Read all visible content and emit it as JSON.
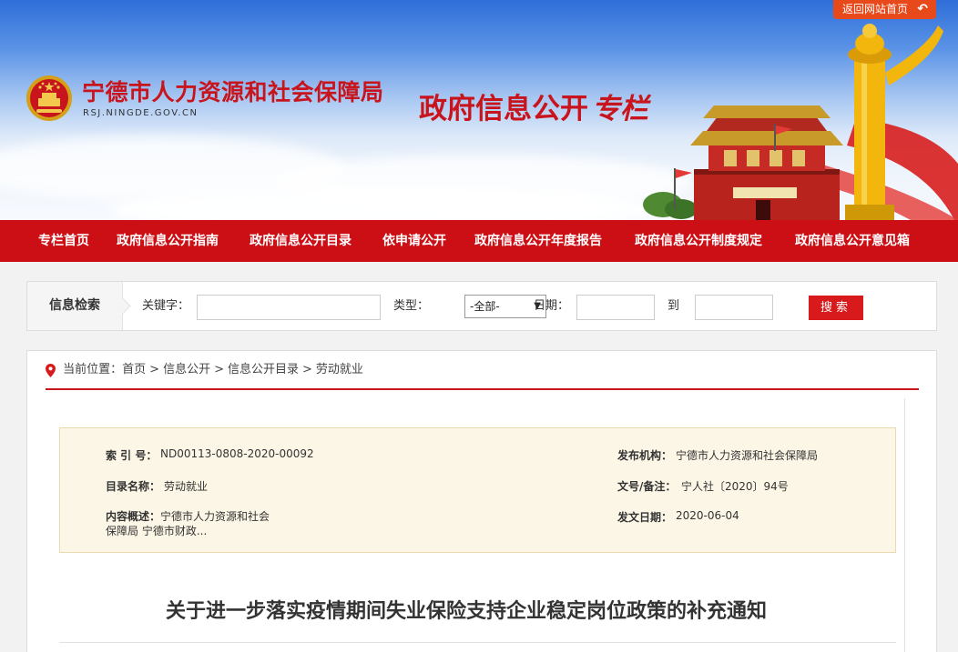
{
  "header": {
    "back_label": "返回网站首页",
    "back_arrow": "↶",
    "org_name": "宁德市人力资源和社会保障局",
    "org_url": "RSJ.NINGDE.GOV.CN",
    "subtitle_main": "政府信息公开",
    "subtitle_accent": "专栏",
    "colors": {
      "brand_red": "#c8151d",
      "back_orange": "#e8491b"
    }
  },
  "nav": {
    "items": [
      {
        "label": "专栏首页"
      },
      {
        "label": "政府信息公开指南"
      },
      {
        "label": "政府信息公开目录"
      },
      {
        "label": "依申请公开"
      },
      {
        "label": "政府信息公开年度报告"
      },
      {
        "label": "政府信息公开制度规定"
      },
      {
        "label": "政府信息公开意见箱"
      }
    ]
  },
  "search": {
    "heading": "信息检索",
    "keyword_label": "关键字：",
    "keyword_value": "",
    "type_label": "类型：",
    "type_selected": "-全部-",
    "date_label": "日期：",
    "date_from": "",
    "to_label": "到",
    "date_to": "",
    "button_label": "搜索"
  },
  "breadcrumb": {
    "prefix": "当前位置：",
    "items": [
      "首页",
      "信息公开",
      "信息公开目录",
      "劳动就业"
    ],
    "separator": ">"
  },
  "meta": {
    "index_label": "索 引 号：",
    "index_value": "ND00113-0808-2020-00092",
    "publisher_label": "发布机构：",
    "publisher_value": "宁德市人力资源和社会保障局",
    "catalog_label": "目录名称：",
    "catalog_value": "劳动就业",
    "docno_label": "文号/备注：",
    "docno_value": "宁人社〔2020〕94号",
    "summary_label": "内容概述：",
    "summary_value": "宁德市人力资源和社会保障局 宁德市财政...",
    "date_label": "发文日期：",
    "date_value": "2020-06-04"
  },
  "article": {
    "title": "关于进一步落实疫情期间失业保险支持企业稳定岗位政策的补充通知"
  }
}
